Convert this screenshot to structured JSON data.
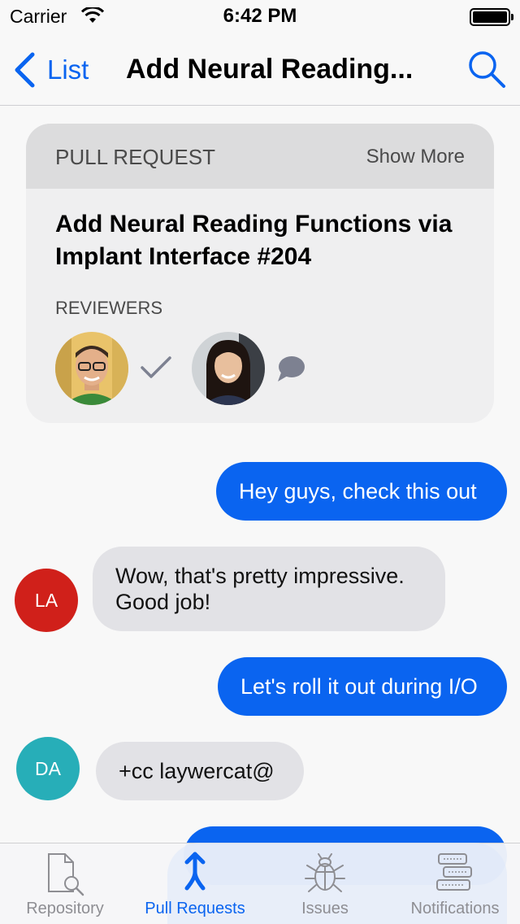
{
  "status_bar": {
    "carrier": "Carrier",
    "time": "6:42 PM"
  },
  "nav": {
    "back_label": "List",
    "title": "Add Neural Reading..."
  },
  "pr_card": {
    "kicker": "PULL REQUEST",
    "show_more": "Show More",
    "title": "Add Neural Reading Functions via Implant Interface #204",
    "reviewers_label": "REVIEWERS",
    "reviewers": [
      {
        "name": "reviewer-1",
        "status_icon": "checkmark-icon"
      },
      {
        "name": "reviewer-2",
        "status_icon": "comment-bubble-icon"
      }
    ]
  },
  "messages": [
    {
      "direction": "outgoing",
      "text": "Hey guys, check this out"
    },
    {
      "direction": "incoming",
      "initials": "LA",
      "text": "Wow, that's pretty impressive. Good job!"
    },
    {
      "direction": "outgoing",
      "text": "Let's roll it out during I/O"
    },
    {
      "direction": "incoming",
      "initials": "DA",
      "text": "+cc laywercat@"
    }
  ],
  "tabs": [
    {
      "label": "Repository",
      "icon": "document-search-icon",
      "active": false
    },
    {
      "label": "Pull Requests",
      "icon": "merge-icon",
      "active": true
    },
    {
      "label": "Issues",
      "icon": "bug-icon",
      "active": false
    },
    {
      "label": "Notifications",
      "icon": "stacked-list-icon",
      "active": false
    }
  ],
  "colors": {
    "accent": "#0a64f0",
    "outgoing_bubble": "#0a64f0",
    "incoming_bubble": "#e2e2e6",
    "avatar_la": "#d0201a",
    "avatar_da": "#27aeb8"
  }
}
